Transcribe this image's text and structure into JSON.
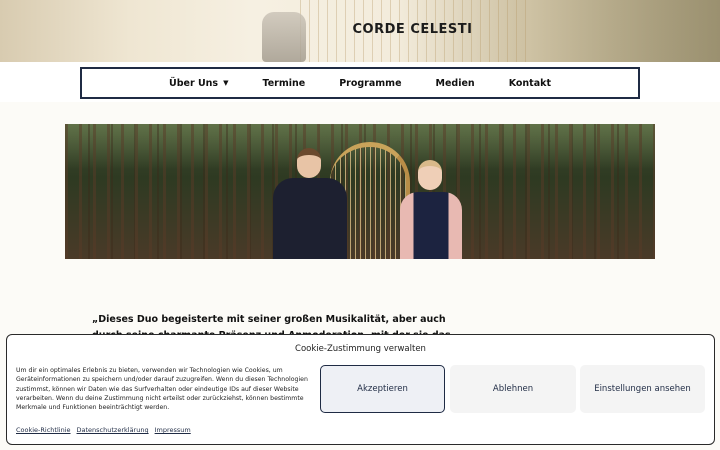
{
  "header": {
    "site_title": "CORDE CELESTI"
  },
  "nav": {
    "items": [
      {
        "label": "Über Uns",
        "has_dropdown": true
      },
      {
        "label": "Termine",
        "has_dropdown": false
      },
      {
        "label": "Programme",
        "has_dropdown": false
      },
      {
        "label": "Medien",
        "has_dropdown": false
      },
      {
        "label": "Kontakt",
        "has_dropdown": false
      }
    ],
    "dropdown_icon": "chevron-down-icon"
  },
  "quote": {
    "text": "„Dieses Duo begeisterte mit seiner großen Musikalität, aber auch durch seine charmante Präsenz und Anmoderation, mit der sie das Publikum"
  },
  "cookie_banner": {
    "title": "Cookie-Zustimmung verwalten",
    "body": "Um dir ein optimales Erlebnis zu bieten, verwenden wir Technologien wie Cookies, um Geräteinformationen zu speichern und/oder darauf zuzugreifen. Wenn du diesen Technologien zustimmst, können wir Daten wie das Surfverhalten oder eindeutige IDs auf dieser Website verarbeiten. Wenn du deine Zustimmung nicht erteilst oder zurückziehst, können bestimmte Merkmale und Funktionen beeinträchtigt werden.",
    "accept_label": "Akzeptieren",
    "deny_label": "Ablehnen",
    "settings_label": "Einstellungen ansehen",
    "links": [
      "Cookie-Richtlinie",
      "Datenschutzerklärung",
      "Impressum"
    ]
  },
  "colors": {
    "accent": "#1f2b44",
    "page_background": "#fcfbf7"
  }
}
